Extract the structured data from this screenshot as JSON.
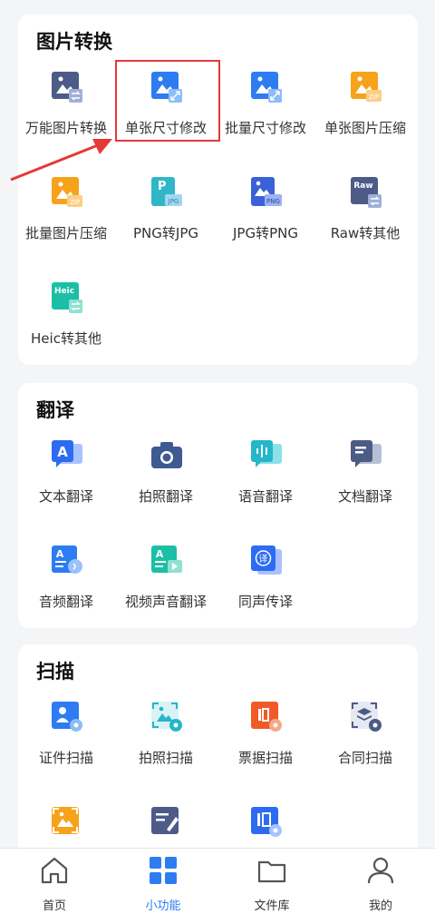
{
  "sections": {
    "image": {
      "title": "图片转换",
      "items": [
        "万能图片转换",
        "单张尺寸修改",
        "批量尺寸修改",
        "单张图片压缩",
        "批量图片压缩",
        "PNG转JPG",
        "JPG转PNG",
        "Raw转其他",
        "Heic转其他"
      ],
      "badges": {
        "zip": "ZIP",
        "jpg": "JPG",
        "png": "PNG",
        "raw": "Raw",
        "heic": "Heic"
      }
    },
    "translate": {
      "title": "翻译",
      "items": [
        "文本翻译",
        "拍照翻译",
        "语音翻译",
        "文档翻译",
        "音频翻译",
        "视频声音翻译",
        "同声传译"
      ],
      "badges": {
        "a": "A",
        "yi": "译"
      }
    },
    "scan": {
      "title": "扫描",
      "items": [
        "证件扫描",
        "拍照扫描",
        "票据扫描",
        "合同扫描"
      ]
    }
  },
  "nav": {
    "items": [
      "首页",
      "小功能",
      "文件库",
      "我的"
    ],
    "active_index": 1
  },
  "colors": {
    "primary_blue": "#2d7cf2",
    "highlight_red": "#e53935",
    "orange": "#f7a21b",
    "teal": "#1cbfa6",
    "slate": "#4d5b87"
  }
}
